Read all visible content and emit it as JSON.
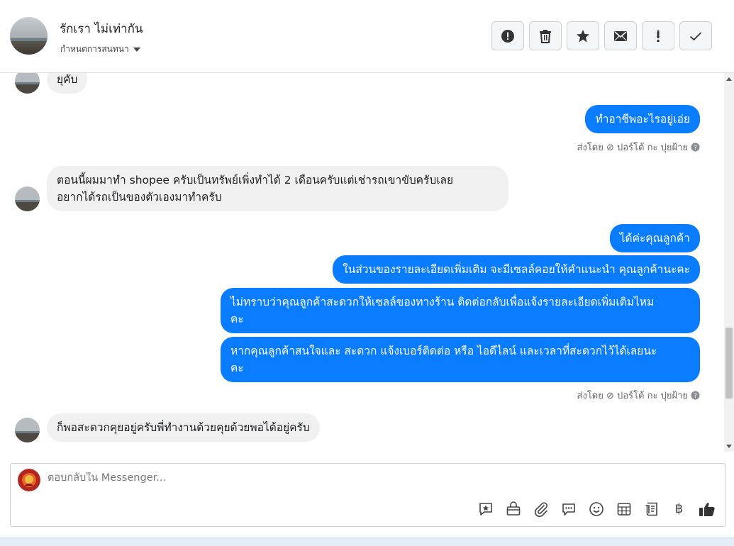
{
  "header": {
    "contact_name": "รักเรา ไม่เท่ากัน",
    "assign_label": "กำหนดการสนทนา",
    "actions": [
      {
        "icon": "alert-circle-icon"
      },
      {
        "icon": "trash-icon"
      },
      {
        "icon": "star-icon"
      },
      {
        "icon": "envelope-icon"
      },
      {
        "icon": "exclamation-icon"
      },
      {
        "icon": "check-icon"
      }
    ]
  },
  "thread": {
    "messages": [
      {
        "from": "customer",
        "text": "ยุคับ"
      },
      {
        "from": "page",
        "text": "ทำอาชีพอะไรอยู่เอ่ย"
      },
      {
        "from": "meta",
        "text": "ส่งโดย ⊘ ปอร์โต้ กะ ปุยฝ้าย"
      },
      {
        "from": "customer",
        "text": "ตอนนี้ผมมาทำ shopee ครับเป็นทรัพย์เพิ่งทำได้ 2 เดือนครับแต่เช่ารถเขาขับครับเลย\nอยากได้รถเป็นของตัวเองมาทำครับ"
      },
      {
        "from": "page",
        "text": "ได้ค่ะคุณลูกค้า"
      },
      {
        "from": "page",
        "text": "ในส่วนของรายละเอียดเพิ่มเติม จะมีเซลล์คอยให้คำแนะนำ คุณลูกค้านะคะ"
      },
      {
        "from": "page",
        "text": "ไม่ทราบว่าคุณลูกค้าสะดวกให้เซลล์ของทางร้าน ติดต่อกลับเพื่อแจ้งรายละเอียดเพิ่มเติมไหม\nคะ"
      },
      {
        "from": "page",
        "text": "หากคุณลูกค้าสนใจและ สะดวก แจ้งเบอร์ติดต่อ หรือ ไอดีไลน์ และเวลาที่สะดวกไว้ได้เลยนะ\nคะ"
      },
      {
        "from": "meta",
        "text": "ส่งโดย ⊘ ปอร์โต้ กะ ปุยฝ้าย"
      },
      {
        "from": "customer",
        "text": "ก็พอสะดวกคุยอยู่ครับพี่ทำงานด้วยคุยด้วยพอได้อยู่ครับ"
      }
    ]
  },
  "composer": {
    "placeholder": "ตอบกลับใน Messenger...",
    "tools": [
      "saved-reply-icon",
      "shopping-bag-icon",
      "paperclip-icon",
      "chat-bubble-icon",
      "emoji-icon",
      "table-icon",
      "receipt-icon",
      "baht-icon",
      "thumbs-up-icon"
    ],
    "baht_symbol": "฿"
  },
  "colors": {
    "outgoing_bubble": "#0a7cff",
    "incoming_bubble": "#f0f0f0"
  }
}
